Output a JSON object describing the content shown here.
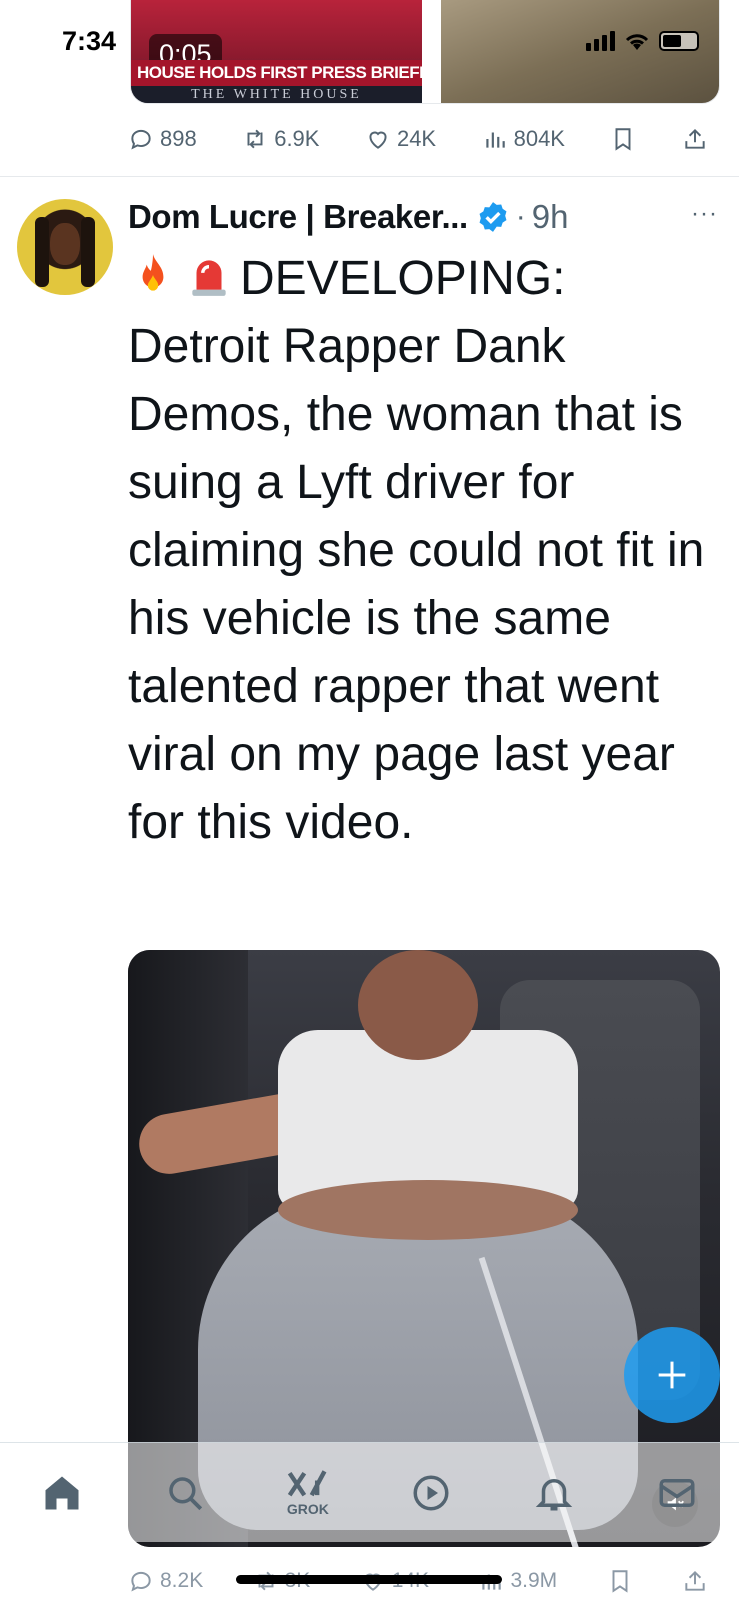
{
  "status_bar": {
    "time": "7:34"
  },
  "previous_tweet": {
    "video_timer": "0:05",
    "chyron_headline": "HOUSE HOLDS FIRST PRESS BRIEFIN",
    "chyron_sub": "THE WHITE HOUSE",
    "actions": {
      "replies": "898",
      "reposts": "6.9K",
      "likes": "24K",
      "views": "804K"
    }
  },
  "tweet": {
    "author": "Dom Lucre | Breaker...",
    "time": "9h",
    "more": "···",
    "emojis": [
      "fire-icon",
      "siren-icon"
    ],
    "text": "DEVELOPING: Detroit Rapper Dank Demos, the woman that is suing a Lyft driver for claiming she could not fit in his vehicle is the same talented rapper that went viral on my page last year for this video.",
    "actions": {
      "replies": "8.2K",
      "reposts": "3K",
      "likes": "14K",
      "views": "3.9M"
    }
  },
  "bottom_nav": {
    "items": [
      "home-icon",
      "search-icon",
      "grok-icon",
      "video-icon",
      "notifications-icon",
      "messages-icon"
    ],
    "grok_label": "GROK"
  },
  "colors": {
    "accent": "#1d9bf0",
    "muted": "#536471",
    "text": "#0f1419"
  }
}
